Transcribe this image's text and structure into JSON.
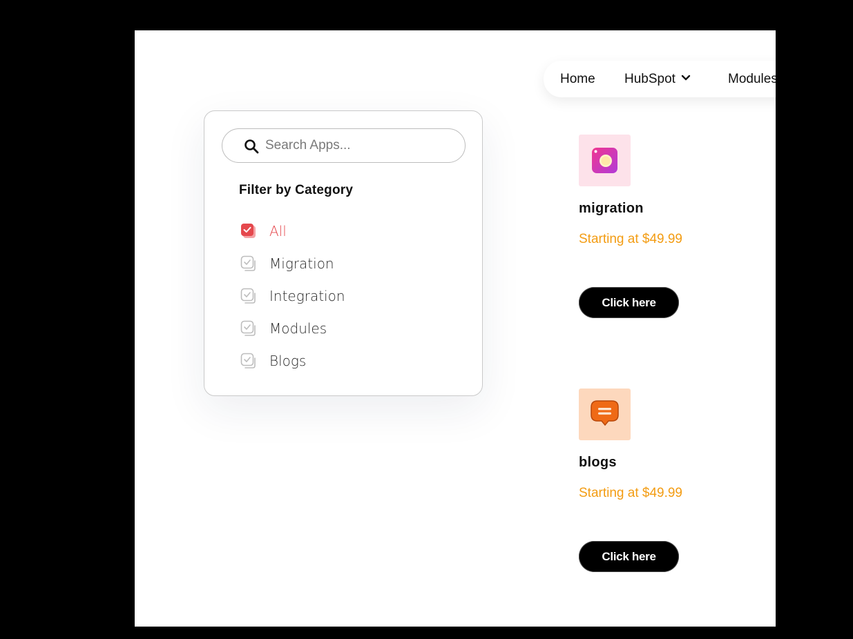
{
  "nav": {
    "items": [
      {
        "label": "Home"
      },
      {
        "label": "HubSpot"
      },
      {
        "label": "Modules"
      }
    ]
  },
  "search": {
    "placeholder": "Search Apps..."
  },
  "filter": {
    "title": "Filter by Category",
    "categories": [
      {
        "label": "All",
        "checked": true
      },
      {
        "label": "Migration",
        "checked": false
      },
      {
        "label": "Integration",
        "checked": false
      },
      {
        "label": "Modules",
        "checked": false
      },
      {
        "label": "Blogs",
        "checked": false
      }
    ]
  },
  "products": [
    {
      "name": "migration",
      "price": "Starting at $49.99",
      "button": "Click here",
      "icon": "camera-app-icon"
    },
    {
      "name": "blogs",
      "price": "Starting at $49.99",
      "button": "Click here",
      "icon": "chat-bubble-icon"
    }
  ],
  "colors": {
    "accent_red": "#e5484d",
    "price_orange": "#f39c12",
    "button_black": "#000000"
  }
}
